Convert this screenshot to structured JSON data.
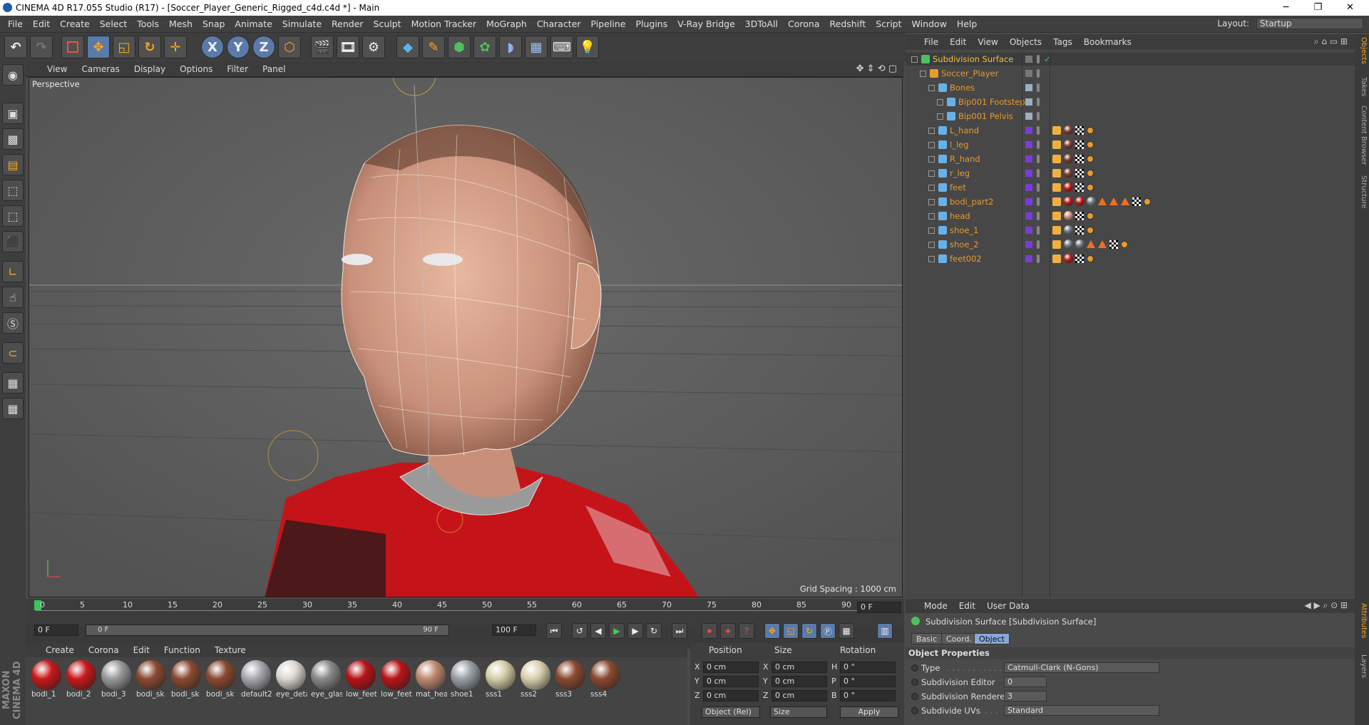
{
  "window": {
    "title": "CINEMA 4D R17.055 Studio (R17) - [Soccer_Player_Generic_Rigged_c4d.c4d *] - Main",
    "controls": [
      "─",
      "❐",
      "✕"
    ]
  },
  "menubar": {
    "items": [
      "File",
      "Edit",
      "Create",
      "Select",
      "Tools",
      "Mesh",
      "Snap",
      "Animate",
      "Simulate",
      "Render",
      "Sculpt",
      "Motion Tracker",
      "MoGraph",
      "Character",
      "Pipeline",
      "Plugins",
      "V-Ray Bridge",
      "3DToAll",
      "Corona",
      "Redshift",
      "Script",
      "Window",
      "Help"
    ],
    "layout_label": "Layout:",
    "layout_value": "Startup"
  },
  "toolbar": {
    "icons": [
      "undo-icon",
      "redo-icon",
      "live-selection-icon",
      "move-icon",
      "scale-icon",
      "rotate-icon",
      "transform-icon",
      "x-axis-icon",
      "y-axis-icon",
      "z-axis-icon",
      "coordinate-system-icon",
      "render-view-icon",
      "render-picture-viewer-icon",
      "edit-render-settings-icon",
      "cube-icon",
      "pen-icon",
      "subdivision-surface-icon",
      "cloner-icon",
      "deformer-icon",
      "floor-icon",
      "camera-icon",
      "light-icon"
    ],
    "axis_labels": [
      "X",
      "Y",
      "Z"
    ]
  },
  "viewport": {
    "menu": [
      "View",
      "Cameras",
      "Display",
      "Options",
      "Filter",
      "Panel"
    ],
    "label": "Perspective",
    "grid_spacing": "Grid Spacing : 1000 cm"
  },
  "timeline": {
    "ticks": [
      "0",
      "5",
      "10",
      "15",
      "20",
      "25",
      "30",
      "35",
      "40",
      "45",
      "50",
      "55",
      "60",
      "65",
      "70",
      "75",
      "80",
      "85",
      "90"
    ],
    "current_frame": "0 F",
    "start": "0 F",
    "range_start": "0 F",
    "range_end": "90 F",
    "end": "100 F"
  },
  "materials": {
    "menu": [
      "Create",
      "Corona",
      "Edit",
      "Function",
      "Texture"
    ],
    "items": [
      {
        "label": "bodi_1",
        "color": "#c8191a"
      },
      {
        "label": "bodi_2",
        "color": "#c8191a"
      },
      {
        "label": "bodi_3",
        "color": "#9a9a9a"
      },
      {
        "label": "bodi_sk",
        "color": "#8a4a32"
      },
      {
        "label": "bodi_sk",
        "color": "#8a4a32"
      },
      {
        "label": "bodi_sk",
        "color": "#8a4a32"
      },
      {
        "label": "default2",
        "color": "#a8a8b0"
      },
      {
        "label": "eye_deta",
        "color": "#ddd8d0"
      },
      {
        "label": "eye_glas",
        "color": "#8a8a8a"
      },
      {
        "label": "low_feet",
        "color": "#b81418"
      },
      {
        "label": "low_feet",
        "color": "#b81418"
      },
      {
        "label": "mat_hea",
        "color": "#c08a70"
      },
      {
        "label": "shoe1",
        "color": "#9aa0a8"
      },
      {
        "label": "sss1",
        "color": "#d4cfa8"
      },
      {
        "label": "sss2",
        "color": "#d8d0b0"
      },
      {
        "label": "sss3",
        "color": "#8a4a30"
      },
      {
        "label": "sss4",
        "color": "#8a4a30"
      }
    ]
  },
  "coordinates": {
    "headers": [
      "Position",
      "Size",
      "Rotation"
    ],
    "rows": [
      {
        "axis": "X",
        "pos": "0 cm",
        "size_axis": "X",
        "size": "0 cm",
        "rot_axis": "H",
        "rot": "0 °"
      },
      {
        "axis": "Y",
        "pos": "0 cm",
        "size_axis": "Y",
        "size": "0 cm",
        "rot_axis": "P",
        "rot": "0 °"
      },
      {
        "axis": "Z",
        "pos": "0 cm",
        "size_axis": "Z",
        "size": "0 cm",
        "rot_axis": "B",
        "rot": "0 °"
      }
    ],
    "mode": "Object (Rel)",
    "size_mode": "Size",
    "apply": "Apply"
  },
  "object_manager": {
    "menu": [
      "File",
      "Edit",
      "View",
      "Objects",
      "Tags",
      "Bookmarks"
    ],
    "objects": [
      {
        "name": "Subdivision Surface",
        "depth": 0,
        "selected": true
      },
      {
        "name": "Soccer_Player",
        "depth": 1
      },
      {
        "name": "Bones",
        "depth": 2
      },
      {
        "name": "Bip001 Footsteps",
        "depth": 3
      },
      {
        "name": "Bip001 Pelvis",
        "depth": 3
      },
      {
        "name": "L_hand",
        "depth": 2
      },
      {
        "name": "l_leg",
        "depth": 2
      },
      {
        "name": "R_hand",
        "depth": 2
      },
      {
        "name": "r_leg",
        "depth": 2
      },
      {
        "name": "feet",
        "depth": 2
      },
      {
        "name": "bodi_part2",
        "depth": 2
      },
      {
        "name": "head",
        "depth": 2
      },
      {
        "name": "shoe_1",
        "depth": 2
      },
      {
        "name": "shoe_2",
        "depth": 2
      },
      {
        "name": "feet002",
        "depth": 2
      }
    ]
  },
  "attributes": {
    "menu": [
      "Mode",
      "Edit",
      "User Data"
    ],
    "title": "Subdivision Surface [Subdivision Surface]",
    "tabs": [
      "Basic",
      "Coord.",
      "Object"
    ],
    "section": "Object Properties",
    "props": [
      {
        "label": "Type",
        "value": "Catmull-Clark (N-Gons)"
      },
      {
        "label": "Subdivision Editor",
        "value": "0"
      },
      {
        "label": "Subdivision Renderer",
        "value": "3"
      },
      {
        "label": "Subdivide UVs",
        "value": "Standard"
      }
    ]
  },
  "right_tabs": [
    "Objects",
    "Takes",
    "Content Browser",
    "Structure",
    "Attributes",
    "Layers"
  ],
  "brand": "MAXON CINEMA 4D"
}
